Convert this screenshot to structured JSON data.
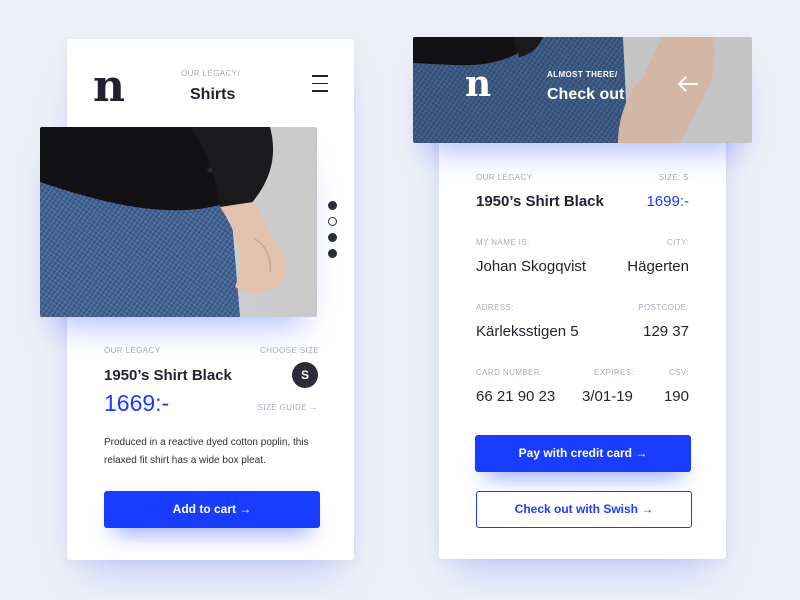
{
  "product_screen": {
    "logo": "n",
    "kicker": "OUR LEGACY/",
    "title": "Shirts",
    "image_slides": 4,
    "active_slide": 2,
    "brand_label": "OUR LEGACY",
    "choose_size_label": "CHOOSE SIZE",
    "product_name": "1950’s Shirt Black",
    "size": "S",
    "price": "1669:-",
    "size_guide": "SIZE GUIDE →",
    "description": "Produced in a reactive dyed cotton poplin, this relaxed fit shirt has a wide box pleat.",
    "add_to_cart": "Add to cart →"
  },
  "checkout_screen": {
    "logo": "n",
    "kicker": "ALMOST THERE/",
    "title": "Check out",
    "brand_label": "OUR LEGACY",
    "size_label": "SIZE: S",
    "product_name": "1950’s Shirt Black",
    "price": "1699:-",
    "name_label": "MY NAME IS:",
    "name_value": "Johan Skogqvist",
    "city_label": "CITY:",
    "city_value": "Hägerten",
    "address_label": "ADRESS:",
    "address_value": "Kärleksstigen 5",
    "postcode_label": "POSTCODE:",
    "postcode_value": "129 37",
    "card_label": "CARD NUMBER:",
    "card_value": "66 21 90 23",
    "expires_label": "EXPIRES:",
    "expires_value": "3/01-19",
    "csv_label": "CSV:",
    "csv_value": "190",
    "pay_button": "Pay with credit card →",
    "swish_button": "Check out with Swish →"
  },
  "colors": {
    "accent": "#1a3cff",
    "background": "#edeff7",
    "text": "#1f2233",
    "muted": "#a9acbb"
  }
}
